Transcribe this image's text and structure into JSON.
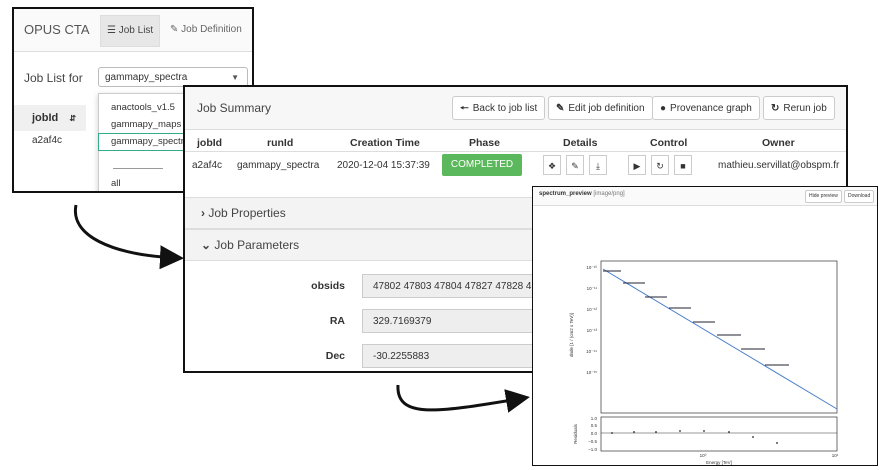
{
  "window1": {
    "brand": "OPUS CTA",
    "tabs": [
      {
        "label": "Job List",
        "icon": "list-icon",
        "active": true
      },
      {
        "label": "Job Definition",
        "icon": "edit-icon",
        "active": false
      }
    ],
    "job_list_label": "Job List for",
    "select_value": "gammapy_spectra",
    "table_header": "jobId",
    "table_row": "a2af4c",
    "dropdown_options": [
      "anactools_v1.5",
      "gammapy_maps",
      "gammapy_spectra",
      "all"
    ],
    "highlighted_option": "gammapy_spectra"
  },
  "window2": {
    "title": "Job Summary",
    "buttons": {
      "back": "Back to job list",
      "edit": "Edit job definition",
      "prov": "Provenance graph",
      "rerun": "Rerun job"
    },
    "columns": [
      "jobId",
      "runId",
      "Creation Time",
      "Phase",
      "Details",
      "Control",
      "Owner"
    ],
    "row": {
      "jobId": "a2af4c",
      "runId": "gammapy_spectra",
      "creation_time": "2020-12-04 15:37:39",
      "phase": "COMPLETED",
      "owner": "mathieu.servillat@obspm.fr"
    },
    "phase_color": "#5cb85c",
    "sections": {
      "properties": "Job Properties",
      "parameters": "Job Parameters"
    },
    "params": [
      {
        "label": "obsids",
        "value": "47802 47803 47804 47827 47828 47"
      },
      {
        "label": "RA",
        "value": "329.7169379"
      },
      {
        "label": "Dec",
        "value": "-30.2255883"
      }
    ]
  },
  "window3": {
    "title": "spectrum_preview",
    "mime": "[image/png]",
    "hide_button": "Hide preview",
    "download_button": "Download",
    "xlabel": "Energy [TeV]",
    "ylabel_top": "dnde [1 / (cm2 s TeV)]",
    "ylabel_bottom": "Residuals",
    "x_ticks": [
      "10⁰",
      "10¹"
    ],
    "y_ticks_top": [
      "10⁻¹⁰",
      "10⁻¹¹",
      "10⁻¹²",
      "10⁻¹³",
      "10⁻¹⁴",
      "10⁻¹⁵"
    ],
    "y_ticks_bottom": [
      "1.0",
      "0.5",
      "0.0",
      "−0.5",
      "−1.0"
    ]
  }
}
